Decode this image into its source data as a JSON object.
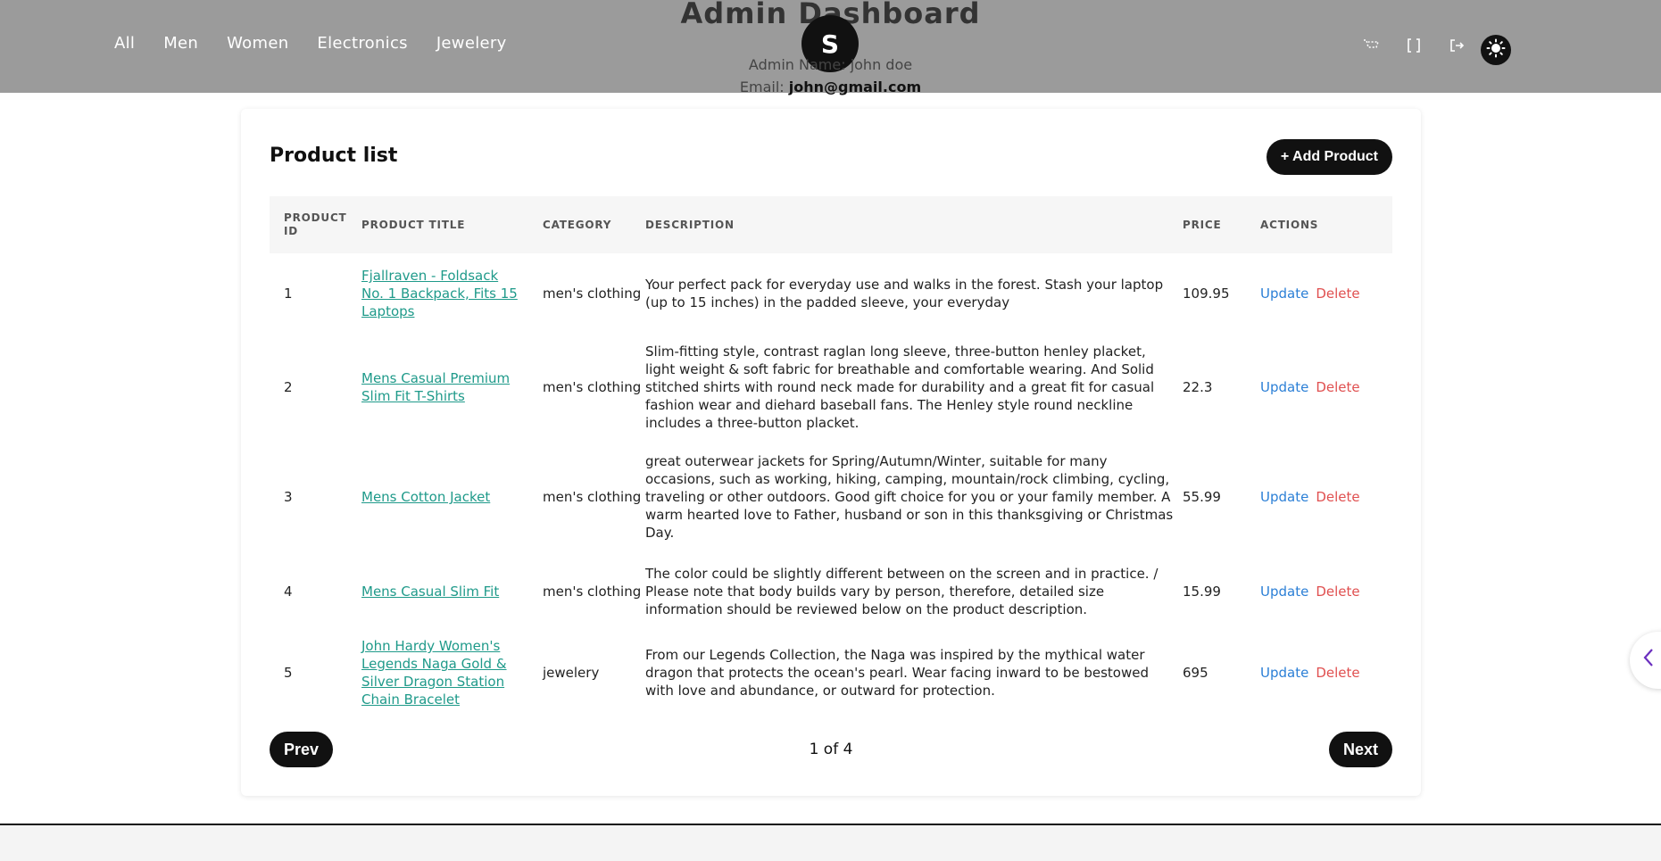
{
  "nav": {
    "items": [
      {
        "label": "All"
      },
      {
        "label": "Men"
      },
      {
        "label": "Women"
      },
      {
        "label": "Electronics"
      },
      {
        "label": "Jewelery"
      }
    ]
  },
  "header": {
    "title": "Admin Dashboard",
    "avatar_initial": "S",
    "admin_name_label": "Admin Name:",
    "admin_name": "john doe",
    "email_label": "Email:",
    "email": "john@gmail.com",
    "icons": [
      "cart-icon",
      "code-brackets-icon",
      "logout-icon",
      "sun-icon"
    ]
  },
  "card": {
    "title": "Product list",
    "add_button": "+ Add Product"
  },
  "table": {
    "headers": {
      "id": "PRODUCT ID",
      "title": "PRODUCT TITLE",
      "category": "CATEGORY",
      "description": "DESCRIPTION",
      "price": "PRICE",
      "actions": "ACTIONS"
    },
    "rows": [
      {
        "id": "1",
        "title": "Fjallraven - Foldsack No. 1 Backpack, Fits 15 Laptops",
        "category": "men's clothing",
        "description": "Your perfect pack for everyday use and walks in the forest. Stash your laptop (up to 15 inches) in the padded sleeve, your everyday",
        "price": "109.95",
        "update": "Update",
        "delete": "Delete"
      },
      {
        "id": "2",
        "title": "Mens Casual Premium Slim Fit T-Shirts",
        "category": "men's clothing",
        "description": "Slim-fitting style, contrast raglan long sleeve, three-button henley placket, light weight & soft fabric for breathable and comfortable wearing. And Solid stitched shirts with round neck made for durability and a great fit for casual fashion wear and diehard baseball fans. The Henley style round neckline includes a three-button placket.",
        "price": "22.3",
        "update": "Update",
        "delete": "Delete"
      },
      {
        "id": "3",
        "title": "Mens Cotton Jacket",
        "category": "men's clothing",
        "description": "great outerwear jackets for Spring/Autumn/Winter, suitable for many occasions, such as working, hiking, camping, mountain/rock climbing, cycling, traveling or other outdoors. Good gift choice for you or your family member. A warm hearted love to Father, husband or son in this thanksgiving or Christmas Day.",
        "price": "55.99",
        "update": "Update",
        "delete": "Delete"
      },
      {
        "id": "4",
        "title": "Mens Casual Slim Fit",
        "category": "men's clothing",
        "description": "The color could be slightly different between on the screen and in practice. / Please note that body builds vary by person, therefore, detailed size information should be reviewed below on the product description.",
        "price": "15.99",
        "update": "Update",
        "delete": "Delete"
      },
      {
        "id": "5",
        "title": "John Hardy Women's Legends Naga Gold & Silver Dragon Station Chain Bracelet",
        "category": "jewelery",
        "description": "From our Legends Collection, the Naga was inspired by the mythical water dragon that protects the ocean's pearl. Wear facing inward to be bestowed with love and abundance, or outward for protection.",
        "price": "695",
        "update": "Update",
        "delete": "Delete"
      }
    ]
  },
  "pagination": {
    "prev": "Prev",
    "info": "1 of 4",
    "next": "Next"
  },
  "colors": {
    "header_bg": "#9b9b9b",
    "link": "#1f9a8a",
    "update": "#2b7fd6",
    "delete": "#e05050",
    "button_bg": "#111111"
  }
}
